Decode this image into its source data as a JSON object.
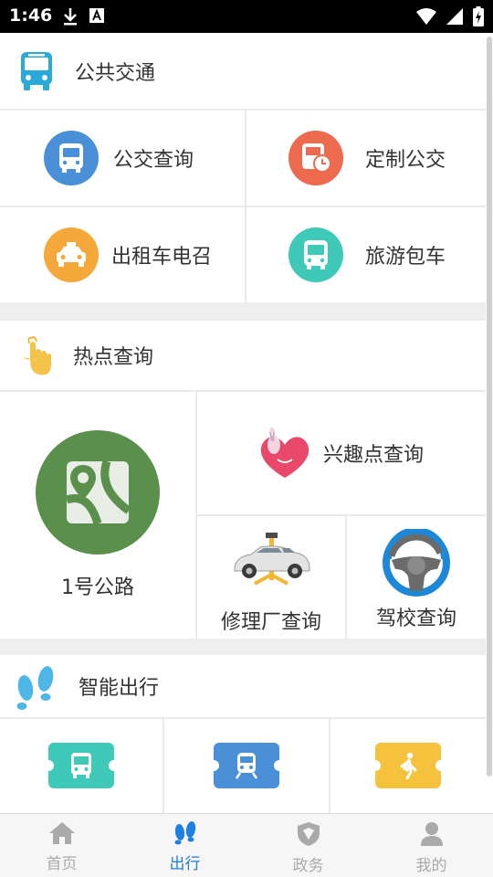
{
  "status_bar": {
    "time": "1:46"
  },
  "sections": {
    "public_transport": {
      "title": "公共交通"
    },
    "hot_query": {
      "title": "热点查询"
    },
    "smart_travel": {
      "title": "智能出行"
    }
  },
  "public_transport_items": [
    {
      "label": "公交查询",
      "color": "#4a90d9"
    },
    {
      "label": "定制公交",
      "color": "#ee6a4e"
    },
    {
      "label": "出租车电召",
      "color": "#f6a93b"
    },
    {
      "label": "旅游包车",
      "color": "#3fc9b8"
    }
  ],
  "hot_query_items": {
    "road": {
      "label": "1号公路",
      "color": "#5a8f4c"
    },
    "poi": {
      "label": "兴趣点查询"
    },
    "repair": {
      "label": "修理厂查询"
    },
    "driving_school": {
      "label": "驾校查询"
    }
  },
  "smart_travel_colors": [
    "#3fc9b8",
    "#4a90d9",
    "#f5c23e"
  ],
  "bottom_nav": [
    {
      "label": "首页",
      "active": false
    },
    {
      "label": "出行",
      "active": true
    },
    {
      "label": "政务",
      "active": false
    },
    {
      "label": "我的",
      "active": false
    }
  ],
  "colors": {
    "accent": "#1f7fe0",
    "inactive": "#aaaaaa",
    "section_icon": "#2aa8d8"
  }
}
